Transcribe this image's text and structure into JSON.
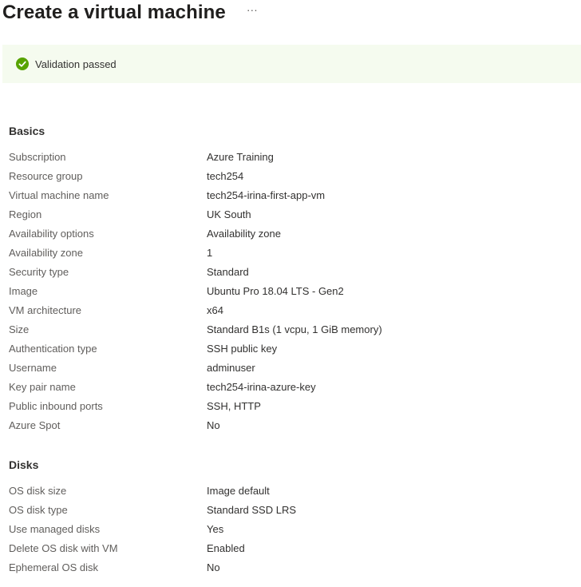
{
  "header": {
    "title": "Create a virtual machine",
    "more_label": "···"
  },
  "validation": {
    "text": "Validation passed",
    "icon": "check-circle-icon",
    "status_color": "#57a300"
  },
  "basics": {
    "title": "Basics",
    "rows": [
      {
        "label": "Subscription",
        "value": "Azure Training"
      },
      {
        "label": "Resource group",
        "value": "tech254"
      },
      {
        "label": "Virtual machine name",
        "value": "tech254-irina-first-app-vm"
      },
      {
        "label": "Region",
        "value": "UK South"
      },
      {
        "label": "Availability options",
        "value": "Availability zone"
      },
      {
        "label": "Availability zone",
        "value": "1"
      },
      {
        "label": "Security type",
        "value": "Standard"
      },
      {
        "label": "Image",
        "value": "Ubuntu Pro 18.04 LTS - Gen2"
      },
      {
        "label": "VM architecture",
        "value": "x64"
      },
      {
        "label": "Size",
        "value": "Standard B1s (1 vcpu, 1 GiB memory)"
      },
      {
        "label": "Authentication type",
        "value": "SSH public key"
      },
      {
        "label": "Username",
        "value": "adminuser"
      },
      {
        "label": "Key pair name",
        "value": "tech254-irina-azure-key"
      },
      {
        "label": "Public inbound ports",
        "value": "SSH, HTTP"
      },
      {
        "label": "Azure Spot",
        "value": "No"
      }
    ]
  },
  "disks": {
    "title": "Disks",
    "rows": [
      {
        "label": "OS disk size",
        "value": "Image default"
      },
      {
        "label": "OS disk type",
        "value": "Standard SSD LRS"
      },
      {
        "label": "Use managed disks",
        "value": "Yes"
      },
      {
        "label": "Delete OS disk with VM",
        "value": "Enabled"
      },
      {
        "label": "Ephemeral OS disk",
        "value": "No"
      }
    ]
  }
}
